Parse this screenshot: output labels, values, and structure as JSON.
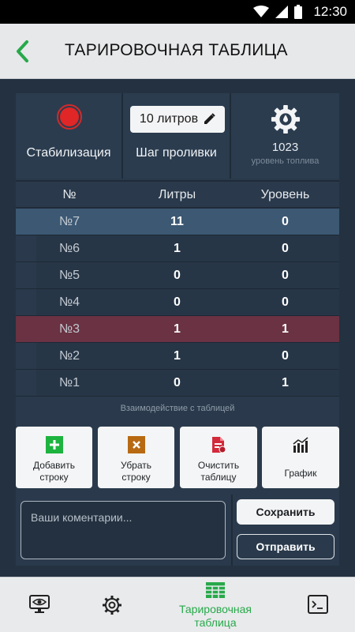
{
  "status_bar": {
    "time": "12:30"
  },
  "app_bar": {
    "title": "ТАРИРОВОЧНАЯ ТАБЛИЦА"
  },
  "controls": {
    "stabilization_label": "Стабилизация",
    "step_value": "10 литров",
    "step_label": "Шаг проливки",
    "fuel_level_value": "1023",
    "fuel_level_label": "уровень топлива"
  },
  "table": {
    "headers": {
      "num": "№",
      "liters": "Литры",
      "level": "Уровень"
    },
    "rows": [
      {
        "num": "№7",
        "liters": "11",
        "level": "0"
      },
      {
        "num": "№6",
        "liters": "1",
        "level": "0"
      },
      {
        "num": "№5",
        "liters": "0",
        "level": "0"
      },
      {
        "num": "№4",
        "liters": "0",
        "level": "0"
      },
      {
        "num": "№3",
        "liters": "1",
        "level": "1"
      },
      {
        "num": "№2",
        "liters": "1",
        "level": "0"
      },
      {
        "num": "№1",
        "liters": "0",
        "level": "1"
      }
    ]
  },
  "interaction": {
    "label": "Взаимодействие с таблицей",
    "add_row": "Добавить строку",
    "remove_row": "Убрать строку",
    "clear_table": "Очистить таблицу",
    "chart": "График"
  },
  "comment": {
    "placeholder": "Ваши коментарии...",
    "save": "Сохранить",
    "send": "Отправить"
  },
  "bottom_nav": {
    "active_label": "Тарировочная таблица"
  },
  "colors": {
    "accent_green": "#27a94a",
    "row_selected_blue": "#3c5873",
    "row_selected_red": "#6a3242",
    "record_red": "#e02626"
  }
}
